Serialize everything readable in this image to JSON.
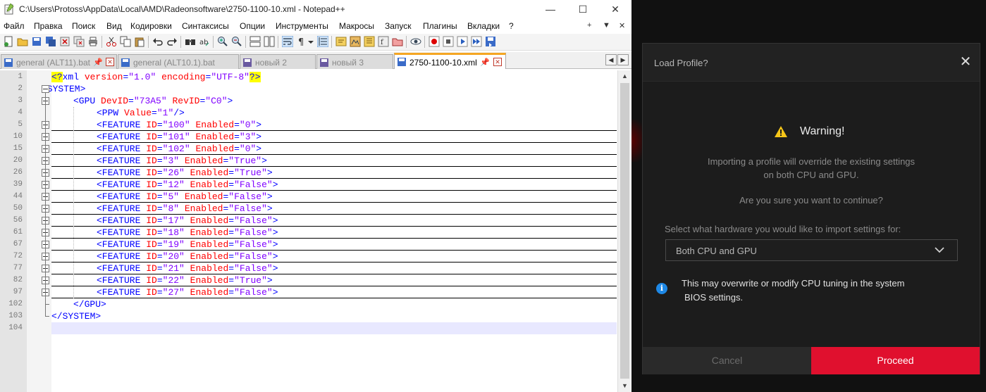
{
  "npp": {
    "title": "C:\\Users\\Protoss\\AppData\\Local\\AMD\\Radeonsoftware\\2750-1100-10.xml - Notepad++",
    "window_buttons": {
      "minimize": "—",
      "maximize": "☐",
      "close": "✕"
    },
    "menu": [
      "Файл",
      "Правка",
      "Поиск",
      "Вид",
      "Кодировки",
      "Синтаксисы",
      "Опции",
      "Инструменты",
      "Макросы",
      "Запуск",
      "Плагины",
      "Вкладки",
      "?"
    ],
    "menu_right": {
      "pin": "+",
      "dropdown": "▼",
      "close": "✕"
    },
    "tabs": [
      {
        "label": "general (ALT11).bat",
        "active": false
      },
      {
        "label": "general (ALT10.1).bat",
        "active": false
      },
      {
        "label": "новый 2",
        "active": false
      },
      {
        "label": "новый 3",
        "active": false
      },
      {
        "label": "2750-1100-10.xml",
        "active": true
      }
    ],
    "tab_pin": "📌",
    "tab_close": "✕",
    "tab_arrows": {
      "left": "◀",
      "right": "▶"
    },
    "scroll_arrows": {
      "up": "▲",
      "down": "▼"
    },
    "lines": [
      {
        "num": "1",
        "parts": [
          [
            "pi",
            "<?"
          ],
          [
            "tag",
            "xml "
          ],
          [
            "attr",
            "version"
          ],
          [
            "tag",
            "="
          ],
          [
            "val",
            "\"1.0\""
          ],
          [
            "tag",
            " "
          ],
          [
            "attr",
            "encoding"
          ],
          [
            "tag",
            "="
          ],
          [
            "val",
            "\"UTF-8\""
          ],
          [
            "pi",
            "?>"
          ]
        ]
      },
      {
        "num": "2",
        "parts": [
          [
            "tag",
            "<SYSTEM>"
          ]
        ]
      },
      {
        "num": "3",
        "parts": [
          [
            "tag",
            "<GPU "
          ],
          [
            "attr",
            "DevID"
          ],
          [
            "tag",
            "="
          ],
          [
            "val",
            "\"73A5\""
          ],
          [
            "tag",
            " "
          ],
          [
            "attr",
            "RevID"
          ],
          [
            "tag",
            "="
          ],
          [
            "val",
            "\"C0\""
          ],
          [
            "tag",
            ">"
          ]
        ]
      },
      {
        "num": "4",
        "parts": [
          [
            "tag",
            "<PPW "
          ],
          [
            "attr",
            "Value"
          ],
          [
            "tag",
            "="
          ],
          [
            "val",
            "\"1\""
          ],
          [
            "tag",
            "/>"
          ]
        ]
      },
      {
        "num": "5",
        "parts": [
          [
            "tag",
            "<FEATURE "
          ],
          [
            "attr",
            "ID"
          ],
          [
            "tag",
            "="
          ],
          [
            "val",
            "\"100\""
          ],
          [
            "tag",
            " "
          ],
          [
            "attr",
            "Enabled"
          ],
          [
            "tag",
            "="
          ],
          [
            "val",
            "\"0\""
          ],
          [
            "tag",
            ">"
          ]
        ]
      },
      {
        "num": "10",
        "parts": [
          [
            "tag",
            "<FEATURE "
          ],
          [
            "attr",
            "ID"
          ],
          [
            "tag",
            "="
          ],
          [
            "val",
            "\"101\""
          ],
          [
            "tag",
            " "
          ],
          [
            "attr",
            "Enabled"
          ],
          [
            "tag",
            "="
          ],
          [
            "val",
            "\"3\""
          ],
          [
            "tag",
            ">"
          ]
        ]
      },
      {
        "num": "15",
        "parts": [
          [
            "tag",
            "<FEATURE "
          ],
          [
            "attr",
            "ID"
          ],
          [
            "tag",
            "="
          ],
          [
            "val",
            "\"102\""
          ],
          [
            "tag",
            " "
          ],
          [
            "attr",
            "Enabled"
          ],
          [
            "tag",
            "="
          ],
          [
            "val",
            "\"0\""
          ],
          [
            "tag",
            ">"
          ]
        ]
      },
      {
        "num": "20",
        "parts": [
          [
            "tag",
            "<FEATURE "
          ],
          [
            "attr",
            "ID"
          ],
          [
            "tag",
            "="
          ],
          [
            "val",
            "\"3\""
          ],
          [
            "tag",
            " "
          ],
          [
            "attr",
            "Enabled"
          ],
          [
            "tag",
            "="
          ],
          [
            "val",
            "\"True\""
          ],
          [
            "tag",
            ">"
          ]
        ]
      },
      {
        "num": "26",
        "parts": [
          [
            "tag",
            "<FEATURE "
          ],
          [
            "attr",
            "ID"
          ],
          [
            "tag",
            "="
          ],
          [
            "val",
            "\"26\""
          ],
          [
            "tag",
            " "
          ],
          [
            "attr",
            "Enabled"
          ],
          [
            "tag",
            "="
          ],
          [
            "val",
            "\"True\""
          ],
          [
            "tag",
            ">"
          ]
        ]
      },
      {
        "num": "39",
        "parts": [
          [
            "tag",
            "<FEATURE "
          ],
          [
            "attr",
            "ID"
          ],
          [
            "tag",
            "="
          ],
          [
            "val",
            "\"12\""
          ],
          [
            "tag",
            " "
          ],
          [
            "attr",
            "Enabled"
          ],
          [
            "tag",
            "="
          ],
          [
            "val",
            "\"False\""
          ],
          [
            "tag",
            ">"
          ]
        ]
      },
      {
        "num": "44",
        "parts": [
          [
            "tag",
            "<FEATURE "
          ],
          [
            "attr",
            "ID"
          ],
          [
            "tag",
            "="
          ],
          [
            "val",
            "\"5\""
          ],
          [
            "tag",
            " "
          ],
          [
            "attr",
            "Enabled"
          ],
          [
            "tag",
            "="
          ],
          [
            "val",
            "\"False\""
          ],
          [
            "tag",
            ">"
          ]
        ]
      },
      {
        "num": "50",
        "parts": [
          [
            "tag",
            "<FEATURE "
          ],
          [
            "attr",
            "ID"
          ],
          [
            "tag",
            "="
          ],
          [
            "val",
            "\"8\""
          ],
          [
            "tag",
            " "
          ],
          [
            "attr",
            "Enabled"
          ],
          [
            "tag",
            "="
          ],
          [
            "val",
            "\"False\""
          ],
          [
            "tag",
            ">"
          ]
        ]
      },
      {
        "num": "56",
        "parts": [
          [
            "tag",
            "<FEATURE "
          ],
          [
            "attr",
            "ID"
          ],
          [
            "tag",
            "="
          ],
          [
            "val",
            "\"17\""
          ],
          [
            "tag",
            " "
          ],
          [
            "attr",
            "Enabled"
          ],
          [
            "tag",
            "="
          ],
          [
            "val",
            "\"False\""
          ],
          [
            "tag",
            ">"
          ]
        ]
      },
      {
        "num": "61",
        "parts": [
          [
            "tag",
            "<FEATURE "
          ],
          [
            "attr",
            "ID"
          ],
          [
            "tag",
            "="
          ],
          [
            "val",
            "\"18\""
          ],
          [
            "tag",
            " "
          ],
          [
            "attr",
            "Enabled"
          ],
          [
            "tag",
            "="
          ],
          [
            "val",
            "\"False\""
          ],
          [
            "tag",
            ">"
          ]
        ]
      },
      {
        "num": "67",
        "parts": [
          [
            "tag",
            "<FEATURE "
          ],
          [
            "attr",
            "ID"
          ],
          [
            "tag",
            "="
          ],
          [
            "val",
            "\"19\""
          ],
          [
            "tag",
            " "
          ],
          [
            "attr",
            "Enabled"
          ],
          [
            "tag",
            "="
          ],
          [
            "val",
            "\"False\""
          ],
          [
            "tag",
            ">"
          ]
        ]
      },
      {
        "num": "72",
        "parts": [
          [
            "tag",
            "<FEATURE "
          ],
          [
            "attr",
            "ID"
          ],
          [
            "tag",
            "="
          ],
          [
            "val",
            "\"20\""
          ],
          [
            "tag",
            " "
          ],
          [
            "attr",
            "Enabled"
          ],
          [
            "tag",
            "="
          ],
          [
            "val",
            "\"False\""
          ],
          [
            "tag",
            ">"
          ]
        ]
      },
      {
        "num": "77",
        "parts": [
          [
            "tag",
            "<FEATURE "
          ],
          [
            "attr",
            "ID"
          ],
          [
            "tag",
            "="
          ],
          [
            "val",
            "\"21\""
          ],
          [
            "tag",
            " "
          ],
          [
            "attr",
            "Enabled"
          ],
          [
            "tag",
            "="
          ],
          [
            "val",
            "\"False\""
          ],
          [
            "tag",
            ">"
          ]
        ]
      },
      {
        "num": "82",
        "parts": [
          [
            "tag",
            "<FEATURE "
          ],
          [
            "attr",
            "ID"
          ],
          [
            "tag",
            "="
          ],
          [
            "val",
            "\"22\""
          ],
          [
            "tag",
            " "
          ],
          [
            "attr",
            "Enabled"
          ],
          [
            "tag",
            "="
          ],
          [
            "val",
            "\"True\""
          ],
          [
            "tag",
            ">"
          ]
        ]
      },
      {
        "num": "97",
        "parts": [
          [
            "tag",
            "<FEATURE "
          ],
          [
            "attr",
            "ID"
          ],
          [
            "tag",
            "="
          ],
          [
            "val",
            "\"27\""
          ],
          [
            "tag",
            " "
          ],
          [
            "attr",
            "Enabled"
          ],
          [
            "tag",
            "="
          ],
          [
            "val",
            "\"False\""
          ],
          [
            "tag",
            ">"
          ]
        ]
      },
      {
        "num": "102",
        "parts": [
          [
            "tag",
            "</GPU>"
          ]
        ]
      },
      {
        "num": "103",
        "parts": [
          [
            "tag",
            "</SYSTEM>"
          ]
        ]
      },
      {
        "num": "104",
        "parts": []
      }
    ],
    "colors": {
      "tag": "#0000ff",
      "attr": "#ff0000",
      "value": "#8000ff",
      "pi_highlight": "#ffff00"
    }
  },
  "dialog": {
    "title": "Load Profile?",
    "close_icon": "✕",
    "warning_title": "Warning!",
    "message_line1": "Importing a profile will override the existing settings",
    "message_line2": "on both CPU and GPU.",
    "confirm_question": "Are you sure you want to continue?",
    "select_label": "Select what hardware you would like to import settings for:",
    "select_value": "Both CPU and GPU",
    "info_icon": "i",
    "info_line1": "This may overwrite or modify CPU tuning in the system",
    "info_line2": "BIOS settings.",
    "cancel_label": "Cancel",
    "proceed_label": "Proceed",
    "colors": {
      "accent": "#e0102e",
      "warning": "#f5c518",
      "info": "#1e88e5"
    }
  }
}
